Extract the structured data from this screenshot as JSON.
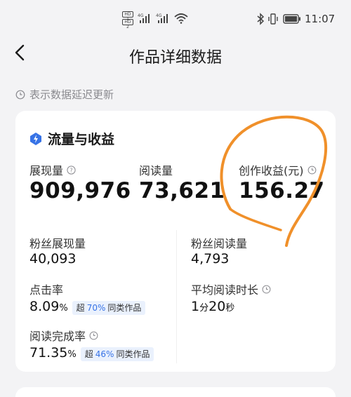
{
  "status_bar": {
    "sim1": "HD 1",
    "sim2": "HD 2",
    "network1": "4G",
    "network2": "4G",
    "time": "11:07",
    "icons": [
      "sim-icon",
      "signal-icon",
      "wifi-icon",
      "bluetooth-icon",
      "vibrate-icon",
      "battery-icon"
    ]
  },
  "header": {
    "back_icon": "chevron-left-icon",
    "title": "作品详细数据"
  },
  "note": {
    "icon": "clock-icon",
    "text": "表示数据延迟更新"
  },
  "section": {
    "icon": "flow-icon",
    "title": "流量与收益"
  },
  "metrics_top": [
    {
      "label": "展现量",
      "value": "909,976",
      "icon": "help-icon"
    },
    {
      "label": "阅读量",
      "value": "73,621"
    },
    {
      "label": "创作收益(元)",
      "value": "156.27",
      "icon": "clock-icon"
    }
  ],
  "metrics_bottom": {
    "fan_impressions": {
      "label": "粉丝展现量",
      "value": "40,093"
    },
    "fan_reads": {
      "label": "粉丝阅读量",
      "value": "4,793"
    },
    "click_rate": {
      "label": "点击率",
      "value": "8.09",
      "unit": "%",
      "badge_prefix": "超",
      "badge_pct": "70%",
      "badge_suffix": "同类作品"
    },
    "avg_read_time": {
      "label": "平均阅读时长",
      "minutes": "1",
      "min_unit": "分",
      "seconds": "20",
      "sec_unit": "秒",
      "icon": "clock-icon"
    },
    "completion_rate": {
      "label": "阅读完成率",
      "value": "71.35",
      "unit": "%",
      "badge_prefix": "超",
      "badge_pct": "46%",
      "badge_suffix": "同类作品",
      "icon": "clock-icon"
    }
  },
  "colors": {
    "background": "#f3f3f5",
    "card": "#ffffff",
    "accent_blue": "#3773e6",
    "badge_bg": "#eaf1fd",
    "annotation_orange": "#f0902a",
    "muted_text": "#8a8a8f"
  }
}
